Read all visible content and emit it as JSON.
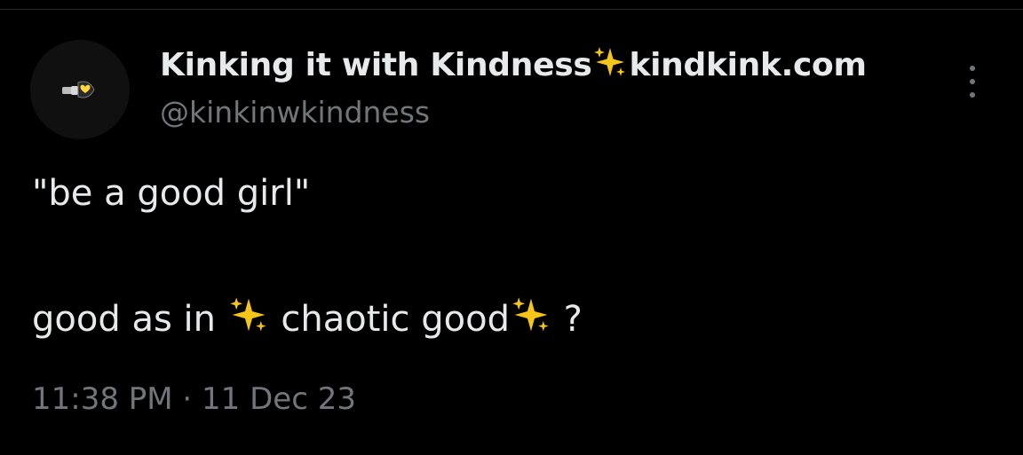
{
  "author": {
    "display_name_part1": "Kinking it with Kindness",
    "display_name_part2": "kindkink.com",
    "handle": "@kinkinwkindness",
    "avatar_icon": "lightbulb-heart-icon"
  },
  "tweet": {
    "line1": "\"be a good girl\"",
    "line2_part1": "good as in ",
    "line2_part2": " chaotic good",
    "line2_part3": " ?"
  },
  "meta": {
    "timestamp": "11:38 PM · 11 Dec 23"
  },
  "icons": {
    "sparkles": "sparkles-icon",
    "more": "more-options-icon"
  },
  "colors": {
    "background": "#000000",
    "text_primary": "#e7e9ea",
    "text_secondary": "#71767b",
    "sparkle": "#f5c518"
  }
}
